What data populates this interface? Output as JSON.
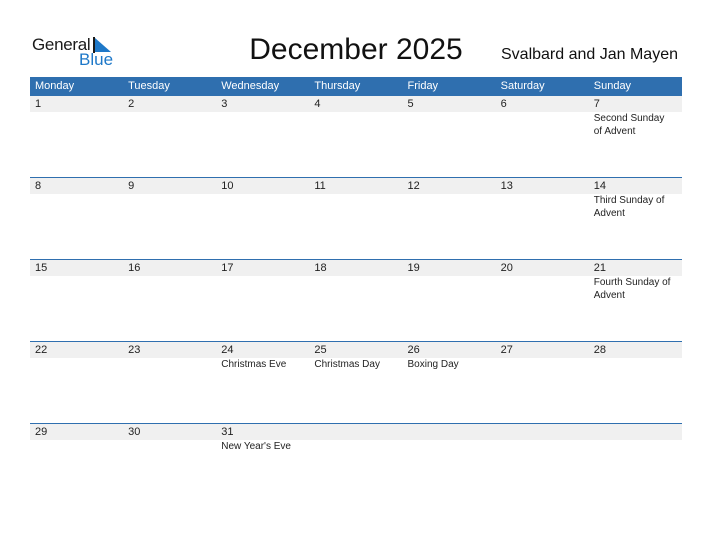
{
  "brand": {
    "line1": "General",
    "line2": "Blue",
    "accent": "#1e78c8"
  },
  "header": {
    "title": "December 2025",
    "country": "Svalbard and Jan Mayen",
    "bar_color": "#2f6faf"
  },
  "weekdays": [
    "Monday",
    "Tuesday",
    "Wednesday",
    "Thursday",
    "Friday",
    "Saturday",
    "Sunday"
  ],
  "weeks": [
    [
      {
        "day": "1",
        "events": ""
      },
      {
        "day": "2",
        "events": ""
      },
      {
        "day": "3",
        "events": ""
      },
      {
        "day": "4",
        "events": ""
      },
      {
        "day": "5",
        "events": ""
      },
      {
        "day": "6",
        "events": ""
      },
      {
        "day": "7",
        "events": "Second Sunday of Advent"
      }
    ],
    [
      {
        "day": "8",
        "events": ""
      },
      {
        "day": "9",
        "events": ""
      },
      {
        "day": "10",
        "events": ""
      },
      {
        "day": "11",
        "events": ""
      },
      {
        "day": "12",
        "events": ""
      },
      {
        "day": "13",
        "events": ""
      },
      {
        "day": "14",
        "events": "Third Sunday of Advent"
      }
    ],
    [
      {
        "day": "15",
        "events": ""
      },
      {
        "day": "16",
        "events": ""
      },
      {
        "day": "17",
        "events": ""
      },
      {
        "day": "18",
        "events": ""
      },
      {
        "day": "19",
        "events": ""
      },
      {
        "day": "20",
        "events": ""
      },
      {
        "day": "21",
        "events": "Fourth Sunday of Advent"
      }
    ],
    [
      {
        "day": "22",
        "events": ""
      },
      {
        "day": "23",
        "events": ""
      },
      {
        "day": "24",
        "events": "Christmas Eve"
      },
      {
        "day": "25",
        "events": "Christmas Day"
      },
      {
        "day": "26",
        "events": "Boxing Day"
      },
      {
        "day": "27",
        "events": ""
      },
      {
        "day": "28",
        "events": ""
      }
    ],
    [
      {
        "day": "29",
        "events": ""
      },
      {
        "day": "30",
        "events": ""
      },
      {
        "day": "31",
        "events": "New Year's Eve"
      },
      {
        "day": "",
        "events": ""
      },
      {
        "day": "",
        "events": ""
      },
      {
        "day": "",
        "events": ""
      },
      {
        "day": "",
        "events": ""
      }
    ]
  ]
}
